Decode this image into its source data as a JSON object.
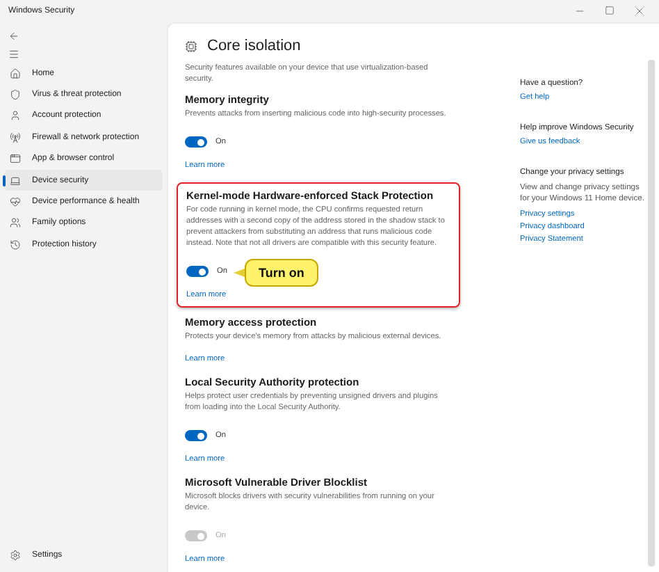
{
  "window": {
    "title": "Windows Security"
  },
  "sidebar": {
    "items": [
      {
        "label": "Home",
        "selected": false
      },
      {
        "label": "Virus & threat protection",
        "selected": false
      },
      {
        "label": "Account protection",
        "selected": false
      },
      {
        "label": "Firewall & network protection",
        "selected": false
      },
      {
        "label": "App & browser control",
        "selected": false
      },
      {
        "label": "Device security",
        "selected": true
      },
      {
        "label": "Device performance & health",
        "selected": false
      },
      {
        "label": "Family options",
        "selected": false
      },
      {
        "label": "Protection history",
        "selected": false
      }
    ],
    "settings": "Settings"
  },
  "page": {
    "title": "Core isolation",
    "description": "Security features available on your device that use virtualization-based security.",
    "sections": [
      {
        "kind": "toggle",
        "title": "Memory integrity",
        "description": "Prevents attacks from inserting malicious code into high-security processes.",
        "toggle": {
          "on": true,
          "disabled": false,
          "label": "On"
        },
        "link": "Learn more",
        "highlighted": false
      },
      {
        "kind": "toggle",
        "title": "Kernel-mode Hardware-enforced Stack Protection",
        "description": "For code running in kernel mode, the CPU confirms requested return addresses with a second copy of the address stored in the shadow stack to prevent attackers from substituting an address that runs malicious code instead. Note that not all drivers are compatible with this security feature.",
        "toggle": {
          "on": true,
          "disabled": false,
          "label": "On"
        },
        "link": "Learn more",
        "highlighted": true,
        "callout": "Turn on"
      },
      {
        "kind": "info",
        "title": "Memory access protection",
        "description": "Protects your device's memory from attacks by malicious external devices.",
        "link": "Learn more",
        "highlighted": false
      },
      {
        "kind": "toggle",
        "title": "Local Security Authority protection",
        "description": "Helps protect user credentials by preventing unsigned drivers and plugins from loading into the Local Security Authority.",
        "toggle": {
          "on": true,
          "disabled": false,
          "label": "On"
        },
        "link": "Learn more",
        "highlighted": false
      },
      {
        "kind": "toggle",
        "title": "Microsoft Vulnerable Driver Blocklist",
        "description": "Microsoft blocks drivers with security vulnerabilities from running on your device.",
        "toggle": {
          "on": true,
          "disabled": true,
          "label": "On"
        },
        "link": "Learn more",
        "highlighted": false
      }
    ]
  },
  "aside": [
    {
      "heading": "Have a question?",
      "links": [
        "Get help"
      ]
    },
    {
      "heading": "Help improve Windows Security",
      "links": [
        "Give us feedback"
      ]
    },
    {
      "heading": "Change your privacy settings",
      "text": "View and change privacy settings for your Windows 11 Home device.",
      "links": [
        "Privacy settings",
        "Privacy dashboard",
        "Privacy Statement"
      ]
    }
  ]
}
